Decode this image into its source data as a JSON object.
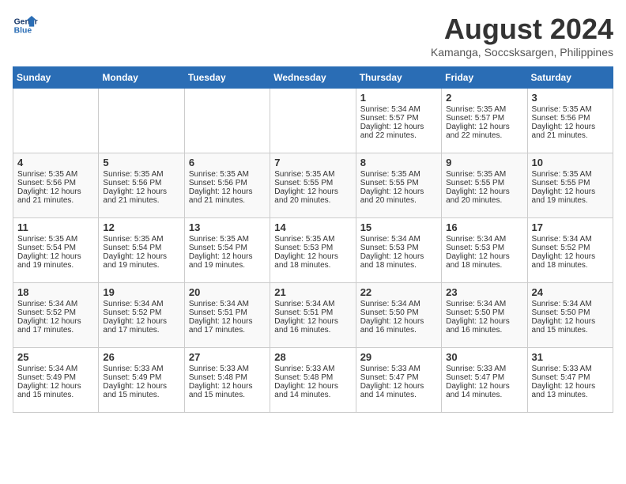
{
  "logo": {
    "line1": "General",
    "line2": "Blue"
  },
  "title": "August 2024",
  "location": "Kamanga, Soccsksargen, Philippines",
  "days_of_week": [
    "Sunday",
    "Monday",
    "Tuesday",
    "Wednesday",
    "Thursday",
    "Friday",
    "Saturday"
  ],
  "weeks": [
    [
      {
        "day": "",
        "sunrise": "",
        "sunset": "",
        "daylight": "",
        "empty": true
      },
      {
        "day": "",
        "sunrise": "",
        "sunset": "",
        "daylight": "",
        "empty": true
      },
      {
        "day": "",
        "sunrise": "",
        "sunset": "",
        "daylight": "",
        "empty": true
      },
      {
        "day": "",
        "sunrise": "",
        "sunset": "",
        "daylight": "",
        "empty": true
      },
      {
        "day": "1",
        "sunrise": "Sunrise: 5:34 AM",
        "sunset": "Sunset: 5:57 PM",
        "daylight": "Daylight: 12 hours and 22 minutes.",
        "empty": false
      },
      {
        "day": "2",
        "sunrise": "Sunrise: 5:35 AM",
        "sunset": "Sunset: 5:57 PM",
        "daylight": "Daylight: 12 hours and 22 minutes.",
        "empty": false
      },
      {
        "day": "3",
        "sunrise": "Sunrise: 5:35 AM",
        "sunset": "Sunset: 5:56 PM",
        "daylight": "Daylight: 12 hours and 21 minutes.",
        "empty": false
      }
    ],
    [
      {
        "day": "4",
        "sunrise": "Sunrise: 5:35 AM",
        "sunset": "Sunset: 5:56 PM",
        "daylight": "Daylight: 12 hours and 21 minutes.",
        "empty": false
      },
      {
        "day": "5",
        "sunrise": "Sunrise: 5:35 AM",
        "sunset": "Sunset: 5:56 PM",
        "daylight": "Daylight: 12 hours and 21 minutes.",
        "empty": false
      },
      {
        "day": "6",
        "sunrise": "Sunrise: 5:35 AM",
        "sunset": "Sunset: 5:56 PM",
        "daylight": "Daylight: 12 hours and 21 minutes.",
        "empty": false
      },
      {
        "day": "7",
        "sunrise": "Sunrise: 5:35 AM",
        "sunset": "Sunset: 5:55 PM",
        "daylight": "Daylight: 12 hours and 20 minutes.",
        "empty": false
      },
      {
        "day": "8",
        "sunrise": "Sunrise: 5:35 AM",
        "sunset": "Sunset: 5:55 PM",
        "daylight": "Daylight: 12 hours and 20 minutes.",
        "empty": false
      },
      {
        "day": "9",
        "sunrise": "Sunrise: 5:35 AM",
        "sunset": "Sunset: 5:55 PM",
        "daylight": "Daylight: 12 hours and 20 minutes.",
        "empty": false
      },
      {
        "day": "10",
        "sunrise": "Sunrise: 5:35 AM",
        "sunset": "Sunset: 5:55 PM",
        "daylight": "Daylight: 12 hours and 19 minutes.",
        "empty": false
      }
    ],
    [
      {
        "day": "11",
        "sunrise": "Sunrise: 5:35 AM",
        "sunset": "Sunset: 5:54 PM",
        "daylight": "Daylight: 12 hours and 19 minutes.",
        "empty": false
      },
      {
        "day": "12",
        "sunrise": "Sunrise: 5:35 AM",
        "sunset": "Sunset: 5:54 PM",
        "daylight": "Daylight: 12 hours and 19 minutes.",
        "empty": false
      },
      {
        "day": "13",
        "sunrise": "Sunrise: 5:35 AM",
        "sunset": "Sunset: 5:54 PM",
        "daylight": "Daylight: 12 hours and 19 minutes.",
        "empty": false
      },
      {
        "day": "14",
        "sunrise": "Sunrise: 5:35 AM",
        "sunset": "Sunset: 5:53 PM",
        "daylight": "Daylight: 12 hours and 18 minutes.",
        "empty": false
      },
      {
        "day": "15",
        "sunrise": "Sunrise: 5:34 AM",
        "sunset": "Sunset: 5:53 PM",
        "daylight": "Daylight: 12 hours and 18 minutes.",
        "empty": false
      },
      {
        "day": "16",
        "sunrise": "Sunrise: 5:34 AM",
        "sunset": "Sunset: 5:53 PM",
        "daylight": "Daylight: 12 hours and 18 minutes.",
        "empty": false
      },
      {
        "day": "17",
        "sunrise": "Sunrise: 5:34 AM",
        "sunset": "Sunset: 5:52 PM",
        "daylight": "Daylight: 12 hours and 18 minutes.",
        "empty": false
      }
    ],
    [
      {
        "day": "18",
        "sunrise": "Sunrise: 5:34 AM",
        "sunset": "Sunset: 5:52 PM",
        "daylight": "Daylight: 12 hours and 17 minutes.",
        "empty": false
      },
      {
        "day": "19",
        "sunrise": "Sunrise: 5:34 AM",
        "sunset": "Sunset: 5:52 PM",
        "daylight": "Daylight: 12 hours and 17 minutes.",
        "empty": false
      },
      {
        "day": "20",
        "sunrise": "Sunrise: 5:34 AM",
        "sunset": "Sunset: 5:51 PM",
        "daylight": "Daylight: 12 hours and 17 minutes.",
        "empty": false
      },
      {
        "day": "21",
        "sunrise": "Sunrise: 5:34 AM",
        "sunset": "Sunset: 5:51 PM",
        "daylight": "Daylight: 12 hours and 16 minutes.",
        "empty": false
      },
      {
        "day": "22",
        "sunrise": "Sunrise: 5:34 AM",
        "sunset": "Sunset: 5:50 PM",
        "daylight": "Daylight: 12 hours and 16 minutes.",
        "empty": false
      },
      {
        "day": "23",
        "sunrise": "Sunrise: 5:34 AM",
        "sunset": "Sunset: 5:50 PM",
        "daylight": "Daylight: 12 hours and 16 minutes.",
        "empty": false
      },
      {
        "day": "24",
        "sunrise": "Sunrise: 5:34 AM",
        "sunset": "Sunset: 5:50 PM",
        "daylight": "Daylight: 12 hours and 15 minutes.",
        "empty": false
      }
    ],
    [
      {
        "day": "25",
        "sunrise": "Sunrise: 5:34 AM",
        "sunset": "Sunset: 5:49 PM",
        "daylight": "Daylight: 12 hours and 15 minutes.",
        "empty": false
      },
      {
        "day": "26",
        "sunrise": "Sunrise: 5:33 AM",
        "sunset": "Sunset: 5:49 PM",
        "daylight": "Daylight: 12 hours and 15 minutes.",
        "empty": false
      },
      {
        "day": "27",
        "sunrise": "Sunrise: 5:33 AM",
        "sunset": "Sunset: 5:48 PM",
        "daylight": "Daylight: 12 hours and 15 minutes.",
        "empty": false
      },
      {
        "day": "28",
        "sunrise": "Sunrise: 5:33 AM",
        "sunset": "Sunset: 5:48 PM",
        "daylight": "Daylight: 12 hours and 14 minutes.",
        "empty": false
      },
      {
        "day": "29",
        "sunrise": "Sunrise: 5:33 AM",
        "sunset": "Sunset: 5:47 PM",
        "daylight": "Daylight: 12 hours and 14 minutes.",
        "empty": false
      },
      {
        "day": "30",
        "sunrise": "Sunrise: 5:33 AM",
        "sunset": "Sunset: 5:47 PM",
        "daylight": "Daylight: 12 hours and 14 minutes.",
        "empty": false
      },
      {
        "day": "31",
        "sunrise": "Sunrise: 5:33 AM",
        "sunset": "Sunset: 5:47 PM",
        "daylight": "Daylight: 12 hours and 13 minutes.",
        "empty": false
      }
    ]
  ]
}
